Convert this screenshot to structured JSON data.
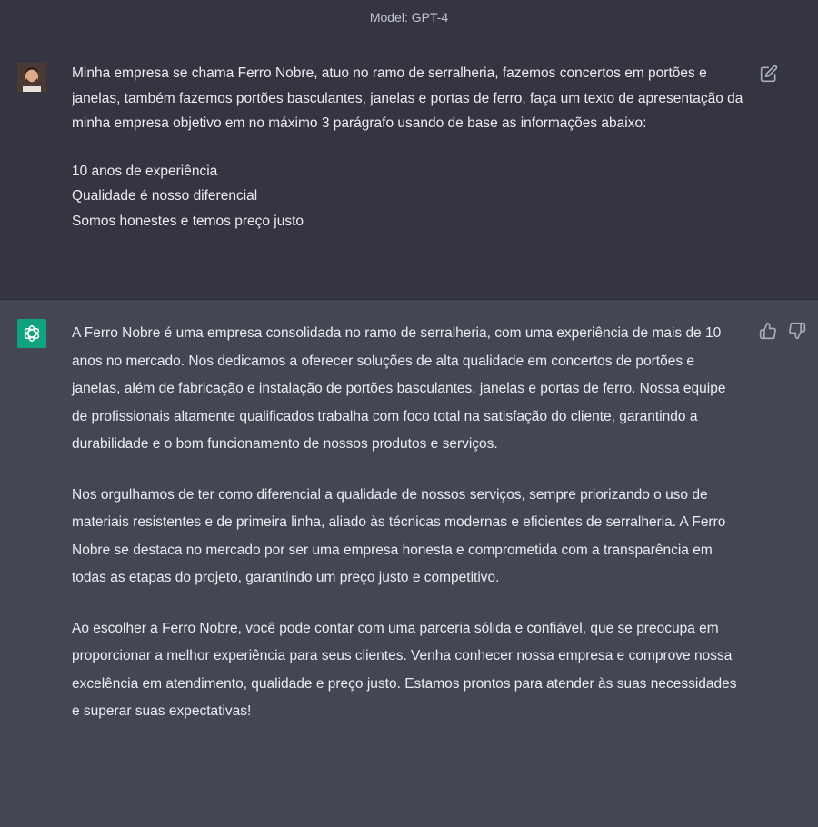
{
  "header": {
    "model_label": "Model: GPT-4"
  },
  "user_message": {
    "paragraph1": "Minha empresa se chama Ferro Nobre, atuo no ramo de serralheria, fazemos concertos em portões e janelas, também fazemos portões basculantes, janelas e portas de ferro, faça um texto de apresentação da minha empresa objetivo em no máximo 3 parágrafo usando de base as informações abaixo:",
    "lines": [
      "10 anos de experiência",
      "Qualidade é nosso diferencial",
      "Somos honestes e temos preço justo"
    ]
  },
  "assistant_message": {
    "paragraphs": [
      "A Ferro Nobre é uma empresa consolidada no ramo de serralheria, com uma experiência de mais de 10 anos no mercado. Nos dedicamos a oferecer soluções de alta qualidade em concertos de portões e janelas, além de fabricação e instalação de portões basculantes, janelas e portas de ferro. Nossa equipe de profissionais altamente qualificados trabalha com foco total na satisfação do cliente, garantindo a durabilidade e o bom funcionamento de nossos produtos e serviços.",
      "Nos orgulhamos de ter como diferencial a qualidade de nossos serviços, sempre priorizando o uso de materiais resistentes e de primeira linha, aliado às técnicas modernas e eficientes de serralheria. A Ferro Nobre se destaca no mercado por ser uma empresa honesta e comprometida com a transparência em todas as etapas do projeto, garantindo um preço justo e competitivo.",
      "Ao escolher a Ferro Nobre, você pode contar com uma parceria sólida e confiável, que se preocupa em proporcionar a melhor experiência para seus clientes. Venha conhecer nossa empresa e comprove nossa excelência em atendimento, qualidade e preço justo. Estamos prontos para atender às suas necessidades e superar suas expectativas!"
    ]
  },
  "icons": {
    "user_avatar": "user-avatar",
    "assistant_avatar": "openai-logo-icon",
    "edit": "edit-icon",
    "thumbs_up": "thumbs-up-icon",
    "thumbs_down": "thumbs-down-icon"
  },
  "colors": {
    "page_bg": "#444654",
    "user_bg": "#343541",
    "assistant_avatar_bg": "#10a37f",
    "text": "#ececf1"
  }
}
